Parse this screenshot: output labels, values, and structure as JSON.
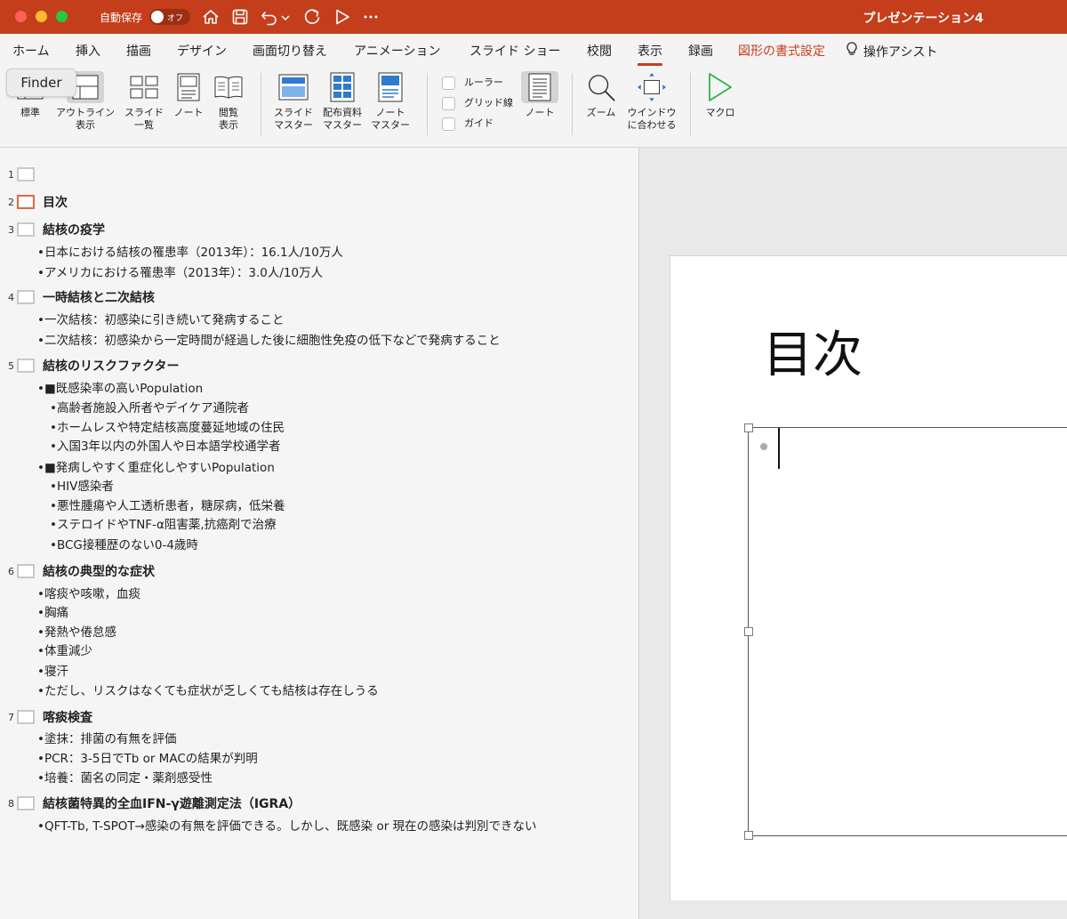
{
  "titlebar": {
    "autosave_label": "自動保存",
    "autosave_state": "オフ",
    "document_title": "プレゼンテーション4",
    "icons": [
      "home-icon",
      "save-icon",
      "undo-icon",
      "undo-dropdown-icon",
      "redo-icon",
      "play-icon",
      "more-icon"
    ]
  },
  "tabs": [
    {
      "label": "ホーム"
    },
    {
      "label": "挿入"
    },
    {
      "label": "描画"
    },
    {
      "label": "デザイン"
    },
    {
      "label": "画面切り替え"
    },
    {
      "label": "アニメーション"
    },
    {
      "label": "スライド ショー"
    },
    {
      "label": "校閲"
    },
    {
      "label": "表示",
      "active": true
    },
    {
      "label": "録画"
    },
    {
      "label": "図形の書式設定",
      "color": "#c43e1c"
    },
    {
      "label": "操作アシスト"
    }
  ],
  "finder_tooltip": "Finder",
  "ribbon": {
    "normal": "標準",
    "outline": [
      "アウトライン",
      "表示"
    ],
    "sorter": [
      "スライド",
      "一覧"
    ],
    "notes_page": "ノート",
    "reading": [
      "閲覧",
      "表示"
    ],
    "slide_master": [
      "スライド",
      "マスター"
    ],
    "handout_master": [
      "配布資料",
      "マスター"
    ],
    "notes_master": [
      "ノート",
      "マスター"
    ],
    "ruler": "ルーラー",
    "gridlines": "グリッド線",
    "guides": "ガイド",
    "notes": "ノート",
    "zoom": "ズーム",
    "fit_window": [
      "ウインドウ",
      "に合わせる"
    ],
    "macro": "マクロ"
  },
  "outline": {
    "slides": [
      {
        "num": "1",
        "title": "",
        "bullets": []
      },
      {
        "num": "2",
        "title": "目次",
        "current": true,
        "bullets": []
      },
      {
        "num": "3",
        "title": "結核の疫学",
        "bullets": [
          {
            "text": "•日本における結核の罹患率（2013年）：16.1人/10万人",
            "level": 1
          },
          {
            "text": "•アメリカにおける罹患率（2013年）：3.0人/10万人",
            "level": 1
          }
        ]
      },
      {
        "num": "4",
        "title": "一時結核と二次結核",
        "bullets": [
          {
            "text": "•一次結核：初感染に引き続いて発病すること",
            "level": 1
          },
          {
            "text": "•二次結核：初感染から一定時間が経過した後に細胞性免疫の低下などで発病すること",
            "level": 1
          }
        ]
      },
      {
        "num": "5",
        "title": "結核のリスクファクター",
        "bullets": [
          {
            "text": "•■既感染率の高いPopulation",
            "level": 1
          },
          {
            "text": "•高齢者施設入所者やデイケア通院者",
            "level": 2
          },
          {
            "text": "•ホームレスや特定結核高度蔓延地域の住民",
            "level": 2
          },
          {
            "text": "•入国3年以内の外国人や日本語学校通学者",
            "level": 2
          },
          {
            "text": "•■発病しやすく重症化しやすいPopulation",
            "level": 1
          },
          {
            "text": "•HIV感染者",
            "level": 2
          },
          {
            "text": "•悪性腫瘍や人工透析患者，糖尿病，低栄養",
            "level": 2
          },
          {
            "text": "•ステロイドやTNF-α阻害薬,抗癌剤で治療",
            "level": 2
          },
          {
            "text": "•BCG接種歴のない0-4歳時",
            "level": 2
          }
        ]
      },
      {
        "num": "6",
        "title": "結核の典型的な症状",
        "bullets": [
          {
            "text": "•喀痰や咳嗽，血痰",
            "level": 1
          },
          {
            "text": "•胸痛",
            "level": 1
          },
          {
            "text": "•発熱や倦怠感",
            "level": 1
          },
          {
            "text": "•体重減少",
            "level": 1
          },
          {
            "text": "•寝汗",
            "level": 1
          },
          {
            "text": "•ただし、リスクはなくても症状が乏しくても結核は存在しうる",
            "level": 1
          }
        ]
      },
      {
        "num": "7",
        "title": "喀痰検査",
        "bullets": [
          {
            "text": "•塗抹：排菌の有無を評価",
            "level": 1
          },
          {
            "text": "•PCR：3-5日でTb or MACの結果が判明",
            "level": 1
          },
          {
            "text": "•培養：菌名の同定・薬剤感受性",
            "level": 1
          }
        ]
      },
      {
        "num": "8",
        "title": "結核菌特異的全血IFN-γ遊離測定法（IGRA）",
        "bullets": [
          {
            "text": "•QFT-Tb, T-SPOT→感染の有無を評価できる。しかし、既感染 or 現在の感染は判別できない",
            "level": 1
          }
        ]
      }
    ]
  },
  "slide": {
    "title": "目次"
  },
  "colors": {
    "accent": "#c43e1c",
    "current_slide": "#e2673f"
  }
}
